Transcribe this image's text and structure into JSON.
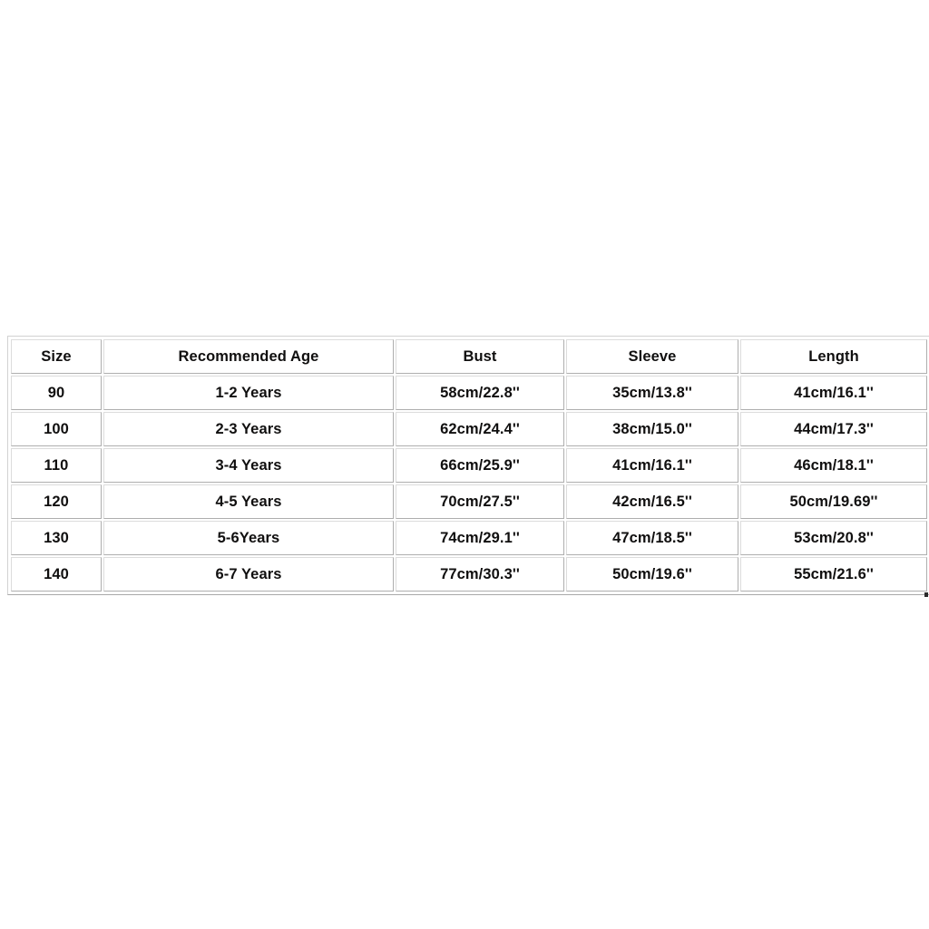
{
  "page": {
    "background_color": "#ffffff",
    "text_color": "#100f0f",
    "border_color": "#c4c4c4"
  },
  "size_chart": {
    "columns": [
      "Size",
      "Recommended Age",
      "Bust",
      "Sleeve",
      "Length"
    ],
    "rows": [
      {
        "size": "90",
        "age": "1-2 Years",
        "bust": "58cm/22.8''",
        "sleeve": "35cm/13.8''",
        "length": "41cm/16.1''"
      },
      {
        "size": "100",
        "age": "2-3 Years",
        "bust": "62cm/24.4''",
        "sleeve": "38cm/15.0''",
        "length": "44cm/17.3''"
      },
      {
        "size": "110",
        "age": "3-4 Years",
        "bust": "66cm/25.9''",
        "sleeve": "41cm/16.1''",
        "length": "46cm/18.1''"
      },
      {
        "size": "120",
        "age": "4-5 Years",
        "bust": "70cm/27.5''",
        "sleeve": "42cm/16.5''",
        "length": "50cm/19.69''"
      },
      {
        "size": "130",
        "age": "5-6Years",
        "bust": "74cm/29.1''",
        "sleeve": "47cm/18.5''",
        "length": "53cm/20.8''"
      },
      {
        "size": "140",
        "age": "6-7 Years",
        "bust": "77cm/30.3''",
        "sleeve": "50cm/19.6''",
        "length": "55cm/21.6''"
      }
    ]
  }
}
